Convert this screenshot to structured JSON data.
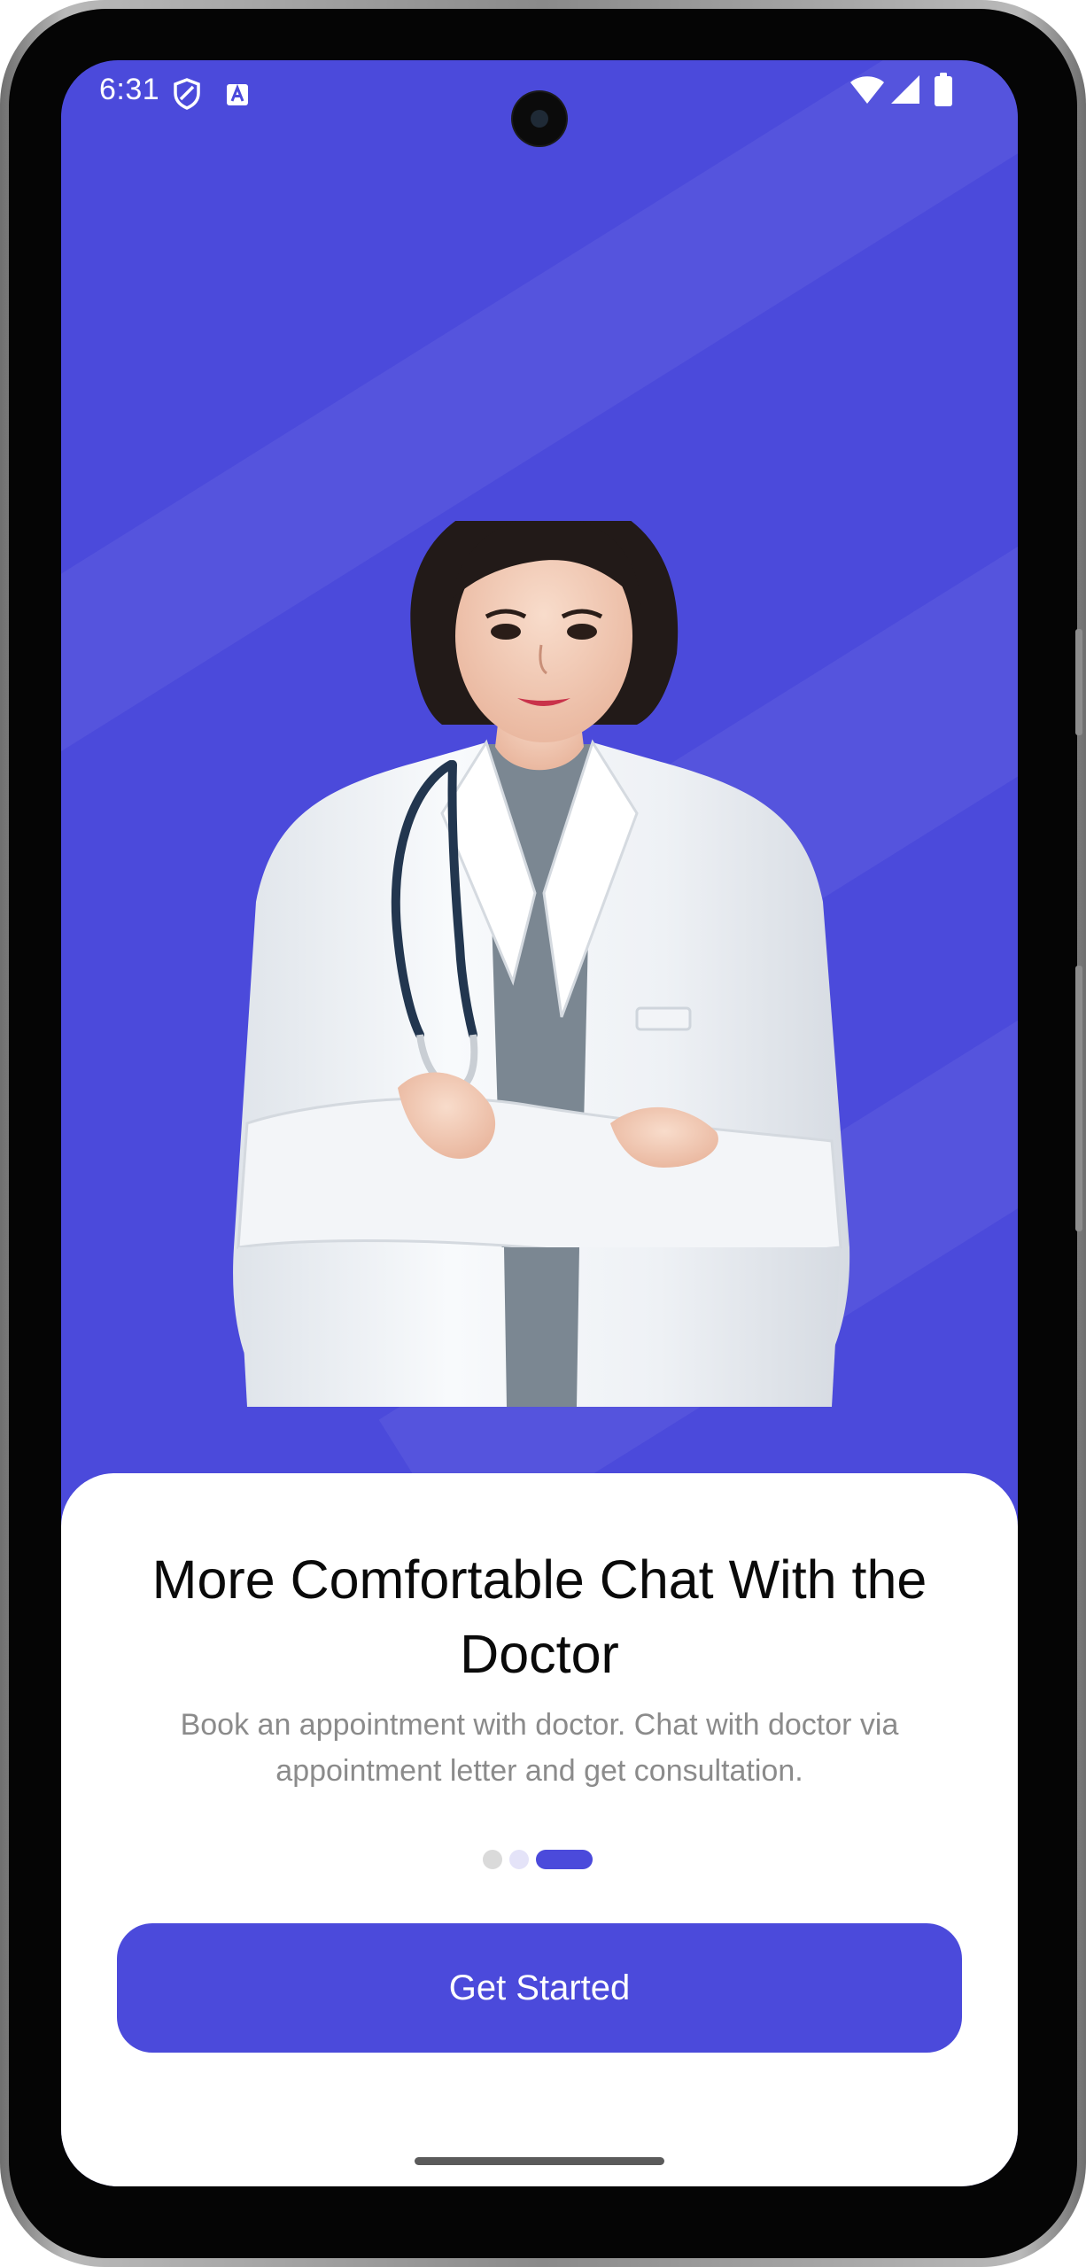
{
  "status_bar": {
    "time": "6:31",
    "left_icons": [
      "shield-icon",
      "font-a-icon"
    ],
    "right_icons": [
      "wifi-icon",
      "cellular-signal-icon",
      "battery-icon"
    ]
  },
  "onboarding": {
    "title": "More Comfortable Chat With the Doctor",
    "description": "Book an appointment with doctor. Chat with doctor via appointment letter and get consultation.",
    "page_indicator": {
      "total": 3,
      "active": 3
    },
    "cta_label": "Get Started"
  },
  "colors": {
    "brand": "#4B4ADB",
    "title_text": "#0A0A0A",
    "body_text": "#8B8B8B",
    "dot_inactive": "#DADADA",
    "dot_inactive_tinted": "#E4E3F8"
  }
}
